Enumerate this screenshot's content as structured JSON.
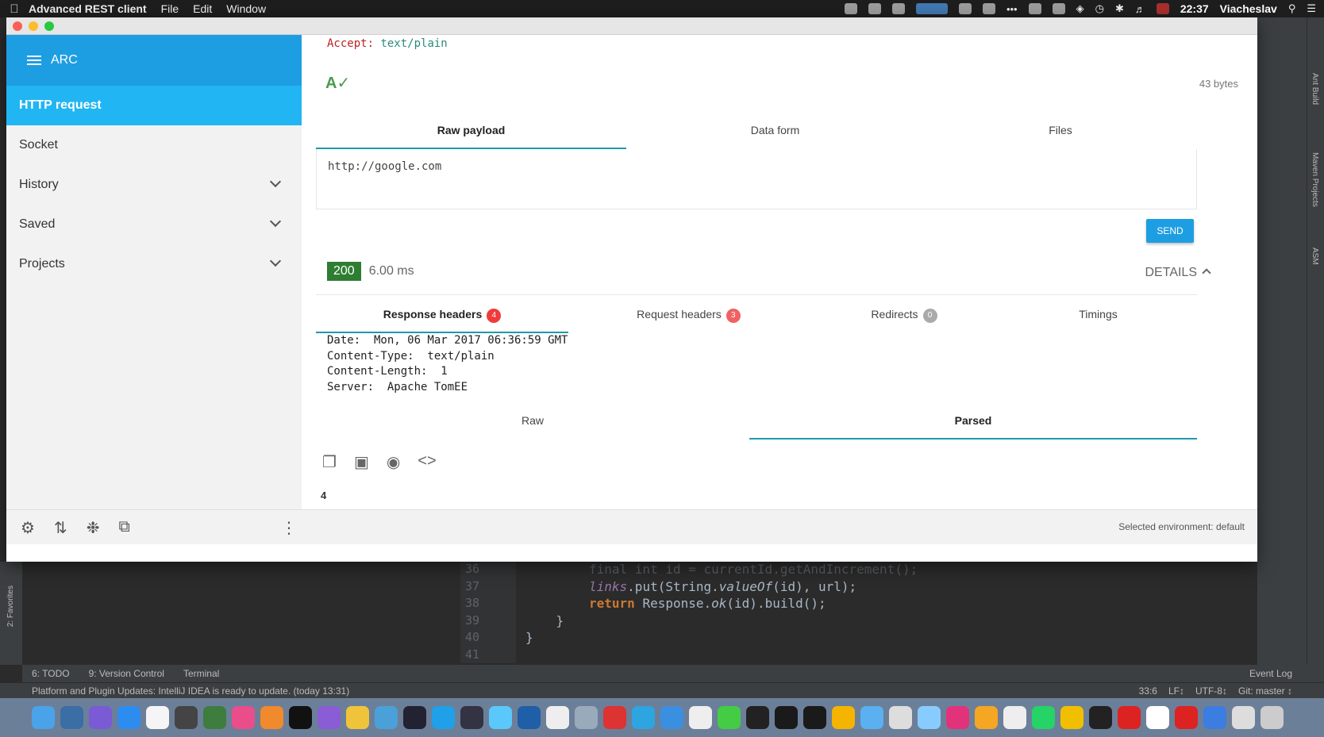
{
  "menubar": {
    "app_name": "Advanced REST client",
    "menus": [
      "File",
      "Edit",
      "Window"
    ],
    "clock": "22:37",
    "user": "Viacheslav"
  },
  "sidebar": {
    "title": "ARC",
    "items": [
      {
        "label": "HTTP request",
        "active": true,
        "expandable": false
      },
      {
        "label": "Socket",
        "active": false,
        "expandable": false
      },
      {
        "label": "History",
        "active": false,
        "expandable": true
      },
      {
        "label": "Saved",
        "active": false,
        "expandable": true
      },
      {
        "label": "Projects",
        "active": false,
        "expandable": true
      }
    ]
  },
  "request": {
    "header_key": "Accept:",
    "header_value": "text/plain",
    "body_size": "43 bytes",
    "body_tabs": [
      "Raw payload",
      "Data form",
      "Files"
    ],
    "payload": "http://google.com",
    "send_label": "SEND"
  },
  "response": {
    "status_code": "200",
    "time": "6.00 ms",
    "details_label": "DETAILS",
    "tabs": [
      {
        "label": "Response headers",
        "count": "4"
      },
      {
        "label": "Request headers",
        "count": "3"
      },
      {
        "label": "Redirects",
        "count": "0"
      },
      {
        "label": "Timings",
        "count": ""
      }
    ],
    "headers_text": "Date:  Mon, 06 Mar 2017 06:36:59 GMT\nContent-Type:  text/plain\nContent-Length:  1\nServer:  Apache TomEE",
    "view_tabs": [
      "Raw",
      "Parsed"
    ],
    "body": "4"
  },
  "footer": {
    "environment": "Selected environment: default"
  },
  "ide": {
    "line_numbers": [
      "36",
      "37",
      "38",
      "39",
      "40",
      "41"
    ],
    "code_line_36": "final int id = currentId.getAndIncrement();",
    "code_line_37_a": "links",
    "code_line_37_b": ".put(String.",
    "code_line_37_c": "valueOf",
    "code_line_37_d": "(id), url);",
    "code_line_38_a": "return ",
    "code_line_38_b": "Response.",
    "code_line_38_c": "ok",
    "code_line_38_d": "(id).build();",
    "code_line_39": "    }",
    "code_line_40": "}",
    "toolwindows": [
      "6: TODO",
      "9: Version Control",
      "Terminal"
    ],
    "event_log": "Event Log",
    "status_message": "Platform and Plugin Updates: IntelliJ IDEA is ready to update. (today 13:31)",
    "status_right": [
      "33:6",
      "LF↕",
      "UTF-8↕",
      "Git: master ↕"
    ],
    "right_tools": [
      "Ant Build",
      "Maven Projects",
      "ASM"
    ],
    "left_tools": [
      "2: Favorites"
    ]
  },
  "colors": {
    "accent": "#1e9ee2",
    "active_item": "#21b5f3",
    "status_ok": "#2e7d32",
    "tab_underline": "#1b9ba8"
  }
}
